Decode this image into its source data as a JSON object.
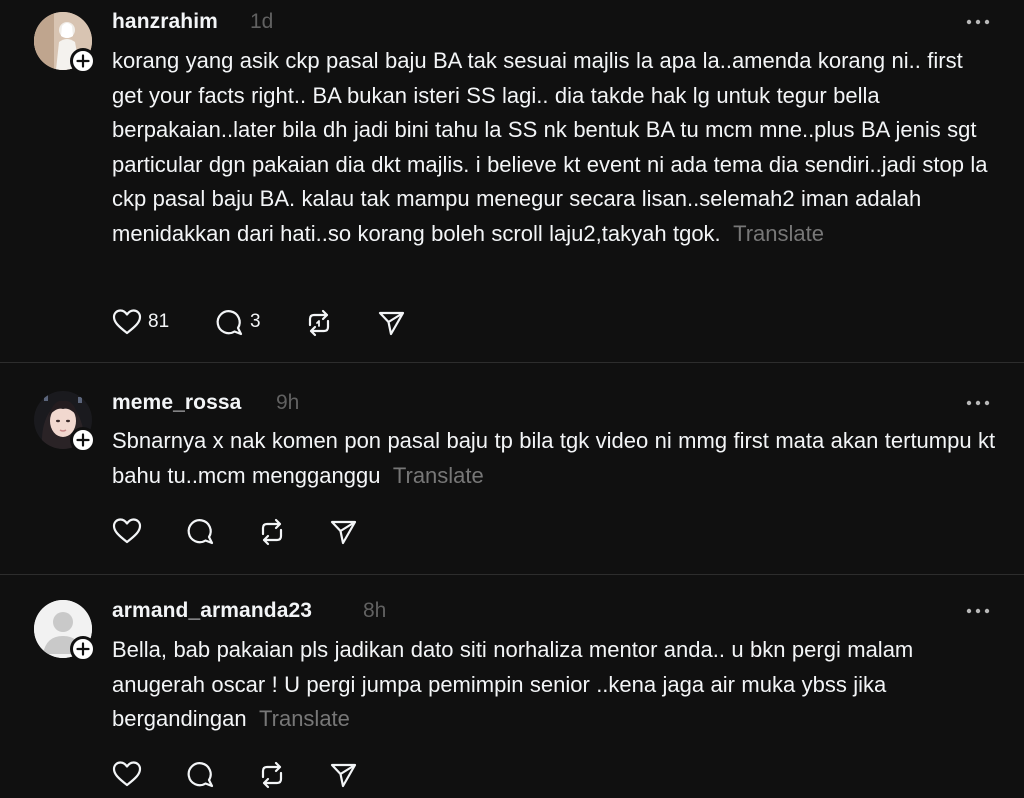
{
  "posts": [
    {
      "username": "hanzrahim",
      "time": "1d",
      "text": "korang yang asik ckp pasal baju BA tak sesuai majlis la apa la..amenda korang ni.. first get your facts right.. BA bukan isteri SS lagi.. dia takde hak lg untuk tegur bella berpakaian..later bila dh jadi bini tahu la SS nk bentuk BA tu mcm mne..plus BA jenis sgt particular dgn pakaian dia dkt majlis. i believe kt event ni ada tema dia sendiri..jadi stop la ckp pasal baju BA. kalau tak mampu menegur secara lisan..selemah2 iman adalah menidakkan dari hati..so korang boleh scroll laju2,takyah tgok.",
      "translate": "Translate",
      "likes": "81",
      "replies": "3"
    },
    {
      "username": "meme_rossa",
      "time": "9h",
      "text": "Sbnarnya x nak komen pon pasal baju tp bila tgk video ni mmg first mata akan tertumpu kt bahu tu..mcm mengganggu",
      "translate": "Translate",
      "likes": "",
      "replies": ""
    },
    {
      "username": "armand_armanda23",
      "time": "8h",
      "text": "Bella, bab pakaian pls jadikan dato siti norhaliza mentor anda.. u bkn pergi malam anugerah oscar ! U pergi jumpa pemimpin senior ..kena jaga air muka ybss jika bergandingan",
      "translate": "Translate",
      "likes": "",
      "replies": ""
    }
  ],
  "icons": {
    "like": "heart-icon",
    "reply": "comment-bubble-icon",
    "repost": "repost-icon",
    "share": "send-icon",
    "more": "more-dots-icon",
    "follow": "plus-icon"
  },
  "colors": {
    "background": "#101010",
    "text": "#f3f5f7",
    "muted": "#777777",
    "divider": "#2d2d2d"
  }
}
